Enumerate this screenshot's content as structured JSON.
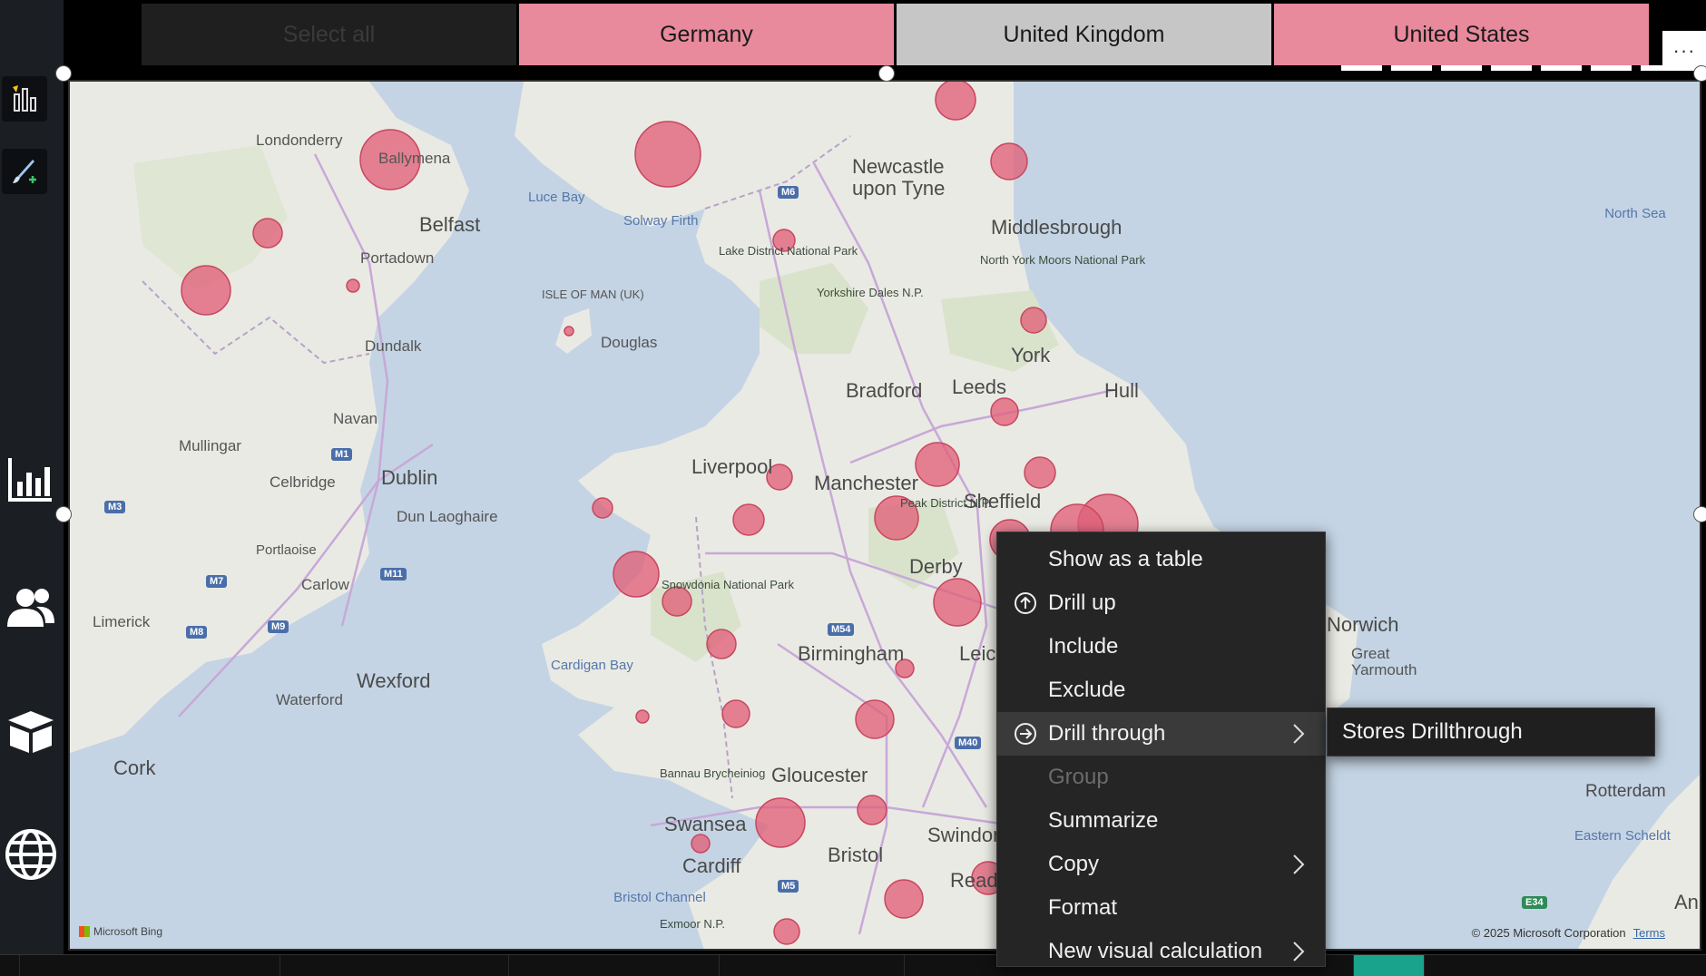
{
  "slicer": {
    "items": [
      {
        "label": "Select all",
        "state": "off"
      },
      {
        "label": "Germany",
        "state": "selected"
      },
      {
        "label": "United Kingdom",
        "state": "unselected"
      },
      {
        "label": "United States",
        "state": "selected"
      }
    ],
    "more_label": "···"
  },
  "rail": {
    "icons": [
      "report-icon",
      "format-brush-icon",
      "bar-chart-icon",
      "people-icon",
      "box-icon",
      "globe-icon"
    ]
  },
  "map": {
    "cities": [
      {
        "name": "Londonderry"
      },
      {
        "name": "Ballymena"
      },
      {
        "name": "Belfast"
      },
      {
        "name": "Portadown"
      },
      {
        "name": "Dundalk"
      },
      {
        "name": "Navan"
      },
      {
        "name": "Mullingar"
      },
      {
        "name": "Celbridge"
      },
      {
        "name": "Dublin"
      },
      {
        "name": "Dun Laoghaire"
      },
      {
        "name": "Portlaoise"
      },
      {
        "name": "Carlow"
      },
      {
        "name": "Limerick"
      },
      {
        "name": "Wexford"
      },
      {
        "name": "Waterford"
      },
      {
        "name": "Cork"
      },
      {
        "name": "Douglas"
      },
      {
        "name": "Newcastle upon Tyne"
      },
      {
        "name": "Middlesbrough"
      },
      {
        "name": "York"
      },
      {
        "name": "Leeds"
      },
      {
        "name": "Bradford"
      },
      {
        "name": "Hull"
      },
      {
        "name": "Liverpool"
      },
      {
        "name": "Manchester"
      },
      {
        "name": "Sheffield"
      },
      {
        "name": "Derby"
      },
      {
        "name": "Birmingham"
      },
      {
        "name": "Leic"
      },
      {
        "name": "Gloucester"
      },
      {
        "name": "Swansea"
      },
      {
        "name": "Cardiff"
      },
      {
        "name": "Bristol"
      },
      {
        "name": "Swindon"
      },
      {
        "name": "Read"
      },
      {
        "name": "Norwich"
      },
      {
        "name": "Great Yarmouth"
      },
      {
        "name": "Rotterdam"
      },
      {
        "name": "An"
      }
    ],
    "seas": [
      "Luce Bay",
      "Solway Firth",
      "ISLE OF MAN (UK)",
      "North Sea",
      "Cardigan Bay",
      "Bristol Channel",
      "Eastern Scheldt"
    ],
    "parks": [
      "Lake District National Park",
      "Yorkshire Dales N.P.",
      "North York Moors National Park",
      "Peak District N.P.",
      "Snowdonia National Park",
      "Bannau Brycheiniog",
      "Exmoor N.P."
    ],
    "roads": [
      "M6",
      "M1",
      "M3",
      "M7",
      "M8",
      "M9",
      "M11",
      "M54",
      "M40",
      "M5",
      "E34"
    ],
    "attribution_left": "Microsoft Bing",
    "attribution_right": "© 2025 Microsoft Corporation",
    "terms": "Terms",
    "bubble_color": "#e0607a"
  },
  "context_menu": {
    "items": [
      {
        "label": "Show as a table",
        "icon": "",
        "submenu": false,
        "disabled": false
      },
      {
        "label": "Drill up",
        "icon": "drill-up-icon",
        "submenu": false,
        "disabled": false
      },
      {
        "label": "Include",
        "icon": "",
        "submenu": false,
        "disabled": false
      },
      {
        "label": "Exclude",
        "icon": "",
        "submenu": false,
        "disabled": false
      },
      {
        "label": "Drill through",
        "icon": "drill-through-icon",
        "submenu": true,
        "disabled": false,
        "highlighted": true
      },
      {
        "label": "Group",
        "icon": "",
        "submenu": false,
        "disabled": true
      },
      {
        "label": "Summarize",
        "icon": "",
        "submenu": false,
        "disabled": false
      },
      {
        "label": "Copy",
        "icon": "",
        "submenu": true,
        "disabled": false
      },
      {
        "label": "Format",
        "icon": "",
        "submenu": false,
        "disabled": false
      },
      {
        "label": "New visual calculation",
        "icon": "",
        "submenu": true,
        "disabled": false
      }
    ],
    "submenu_item": "Stores Drillthrough"
  }
}
